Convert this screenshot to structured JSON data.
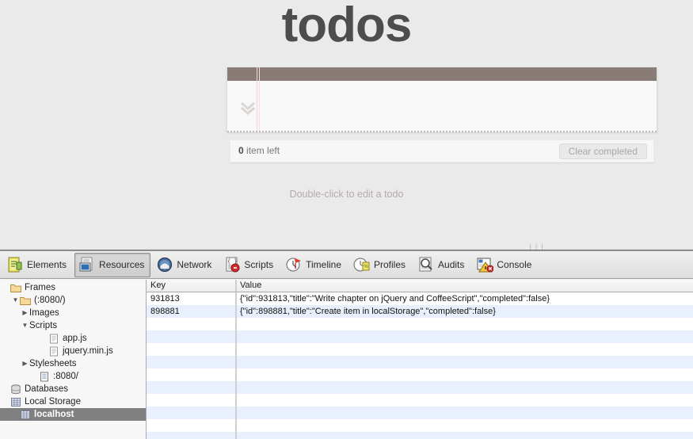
{
  "page": {
    "title": "todos",
    "toggle_all_icon": "chevron-double-down-icon",
    "footer": {
      "count_number": "0",
      "count_label": " item left",
      "clear_completed_label": "Clear completed"
    },
    "hint": "Double-click to edit a todo",
    "colors": {
      "background": "#eaeaea",
      "title_text": "#4d4d4d",
      "top_bar": "#897b75",
      "hint_text": "#b5aaaa",
      "card_background": "#f8f8f8"
    }
  },
  "splitter": {
    "grip_label": "|||"
  },
  "devtools": {
    "tabs": [
      {
        "label": "Elements",
        "icon": "elements-icon",
        "selected": false
      },
      {
        "label": "Resources",
        "icon": "resources-icon",
        "selected": true
      },
      {
        "label": "Network",
        "icon": "network-icon",
        "selected": false
      },
      {
        "label": "Scripts",
        "icon": "scripts-icon",
        "selected": false
      },
      {
        "label": "Timeline",
        "icon": "timeline-icon",
        "selected": false
      },
      {
        "label": "Profiles",
        "icon": "profiles-icon",
        "selected": false
      },
      {
        "label": "Audits",
        "icon": "audits-icon",
        "selected": false
      },
      {
        "label": "Console",
        "icon": "console-icon",
        "selected": false
      }
    ],
    "sidebar": [
      {
        "label": "Frames",
        "icon": "folder-icon",
        "indent": 0,
        "disclosure": "",
        "selected": false
      },
      {
        "label": "(:8080/)",
        "icon": "folder-icon",
        "indent": 1,
        "disclosure": "expanded",
        "selected": false
      },
      {
        "label": "Images",
        "icon": "none",
        "indent": 2,
        "disclosure": "collapsed",
        "selected": false
      },
      {
        "label": "Scripts",
        "icon": "none",
        "indent": 2,
        "disclosure": "expanded",
        "selected": false
      },
      {
        "label": "app.js",
        "icon": "script-file-icon",
        "indent": 4,
        "disclosure": "",
        "selected": false
      },
      {
        "label": "jquery.min.js",
        "icon": "script-file-icon",
        "indent": 4,
        "disclosure": "",
        "selected": false
      },
      {
        "label": "Stylesheets",
        "icon": "none",
        "indent": 2,
        "disclosure": "collapsed",
        "selected": false
      },
      {
        "label": ":8080/",
        "icon": "document-file-icon",
        "indent": 3,
        "disclosure": "",
        "selected": false
      },
      {
        "label": "Databases",
        "icon": "database-icon",
        "indent": 0,
        "disclosure": "",
        "selected": false
      },
      {
        "label": "Local Storage",
        "icon": "storage-grid-icon",
        "indent": 0,
        "disclosure": "",
        "selected": false
      },
      {
        "label": "localhost",
        "icon": "storage-grid-icon",
        "indent": 1,
        "disclosure": "",
        "selected": true
      }
    ],
    "table": {
      "columns": [
        "Key",
        "Value"
      ],
      "rows": [
        {
          "key": "931813",
          "value": "{\"id\":931813,\"title\":\"Write chapter on jQuery and CoffeeScript\",\"completed\":false}"
        },
        {
          "key": "898881",
          "value": "{\"id\":898881,\"title\":\"Create item in localStorage\",\"completed\":false}"
        }
      ],
      "empty_row_count": 10
    }
  }
}
